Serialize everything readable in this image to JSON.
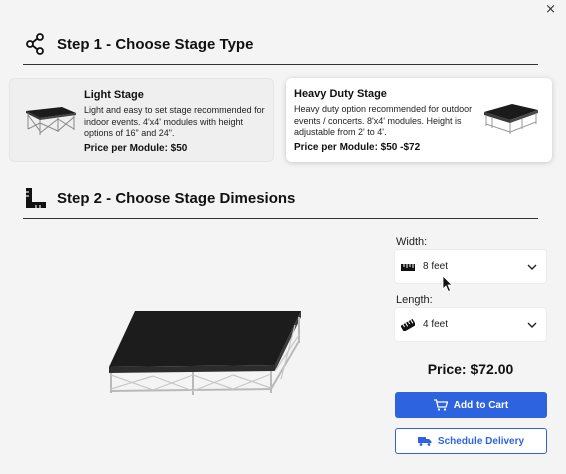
{
  "close_label": "×",
  "step1": {
    "title": "Step 1 - Choose Stage Type"
  },
  "step2": {
    "title": "Step 2 - Choose Stage Dimesions"
  },
  "stage_types": {
    "light": {
      "name": "Light Stage",
      "description": "Light and easy to set stage recommended for indoor events. 4'x4' modules with height options of 16\" and 24\".",
      "price": "Price per Module: $50"
    },
    "heavy": {
      "name": "Heavy Duty Stage",
      "description": "Heavy duty option recommended for outdoor events / concerts. 8'x4' modules. Height is adjustable from 2' to 4'.",
      "price": "Price per Module: $50 -$72",
      "selected": true
    }
  },
  "dimensions": {
    "width_label": "Width:",
    "width_value": "8 feet",
    "length_label": "Length:",
    "length_value": "4 feet"
  },
  "total_price": "Price: $72.00",
  "buttons": {
    "add_to_cart": "Add to Cart",
    "schedule_delivery": "Schedule Delivery"
  },
  "colors": {
    "accent": "#2e63e0",
    "background": "#f4f4f4"
  },
  "icons": [
    "share-icon",
    "ruler-angle-icon",
    "ruler-icon",
    "chevron-down-icon",
    "cart-icon",
    "truck-icon",
    "close-icon"
  ]
}
